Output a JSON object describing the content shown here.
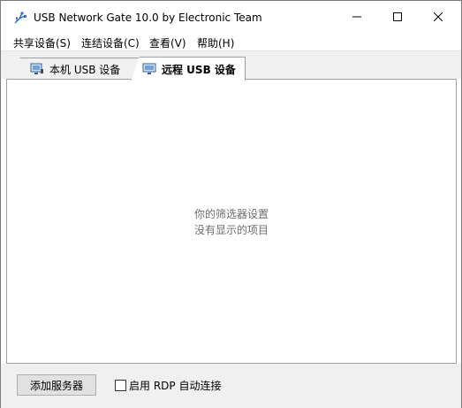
{
  "window": {
    "title": "USB Network Gate 10.0 by Electronic Team",
    "controls": {
      "minimize_icon": "minimize-icon",
      "maximize_icon": "maximize-icon",
      "close_icon": "close-icon"
    }
  },
  "menu": {
    "items": [
      {
        "label": "共享设备(S)"
      },
      {
        "label": "连结设备(C)"
      },
      {
        "label": "查看(V)"
      },
      {
        "label": "帮助(H)"
      }
    ]
  },
  "tabs": [
    {
      "label": "本机 USB 设备",
      "icon": "computer-usb-icon",
      "selected": false
    },
    {
      "label": "远程 USB 设备",
      "icon": "monitor-icon",
      "selected": true
    }
  ],
  "content": {
    "empty_line1": "你的筛选器设置",
    "empty_line2": "没有显示的项目"
  },
  "bottom": {
    "add_server_label": "添加服务器",
    "rdp_checkbox_label": "启用 RDP 自动连接",
    "rdp_checked": false
  },
  "colors": {
    "tab_strip_bg": "#f0f0f0",
    "content_bg": "#ffffff",
    "message_text": "#6d6d6d",
    "app_icon_blue": "#2f6fd6"
  }
}
